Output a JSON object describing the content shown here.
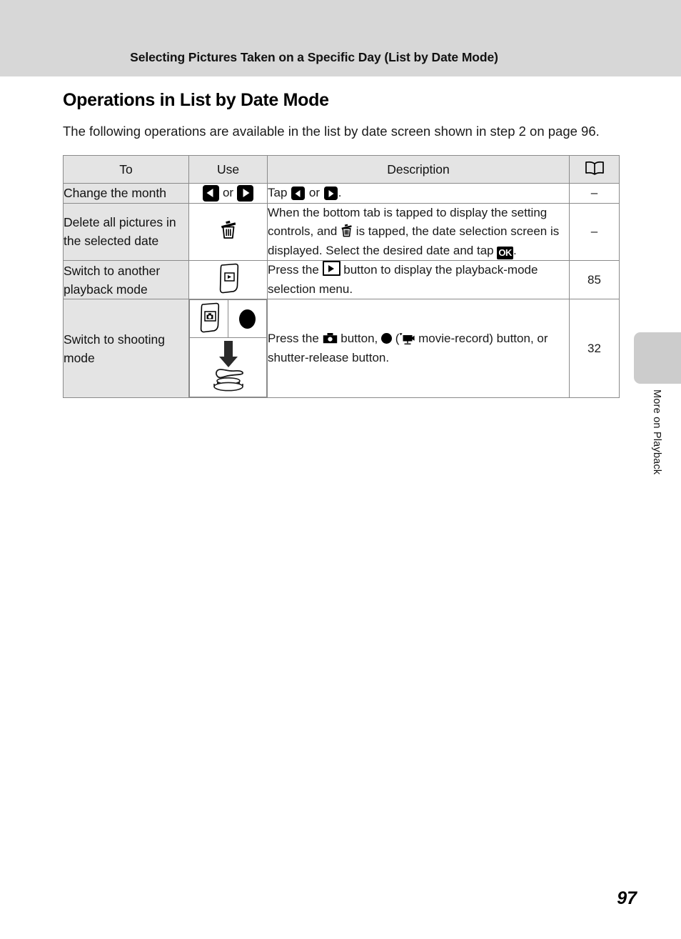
{
  "header": {
    "running_title": "Selecting Pictures Taken on a Specific Day (List by Date Mode)"
  },
  "section": {
    "title": "Operations in List by Date Mode",
    "intro": "The following operations are available in the list by date screen shown in step 2 on page 96."
  },
  "table": {
    "columns": {
      "to": "To",
      "use": "Use",
      "description": "Description",
      "reference_icon": "open-book-icon"
    },
    "rows": [
      {
        "to": "Change the month",
        "use_icons": [
          "left-arrow-button-icon",
          "or",
          "right-arrow-button-icon"
        ],
        "use_connector": "or",
        "description_parts": [
          {
            "type": "text",
            "value": "Tap "
          },
          {
            "type": "icon",
            "value": "left-arrow-button-icon"
          },
          {
            "type": "text",
            "value": " or "
          },
          {
            "type": "icon",
            "value": "right-arrow-button-icon"
          },
          {
            "type": "text",
            "value": "."
          }
        ],
        "description_plain": "Tap ◀ or ▶.",
        "reference": "–"
      },
      {
        "to": "Delete all pictures in the selected date",
        "use_icons": [
          "trash-can-icon"
        ],
        "description_parts": [
          {
            "type": "text",
            "value": "When the bottom tab is tapped to display the setting controls, and "
          },
          {
            "type": "icon",
            "value": "trash-can-icon"
          },
          {
            "type": "text",
            "value": " is tapped, the date selection screen is displayed. Select the desired date and tap "
          },
          {
            "type": "icon",
            "value": "ok-button-icon"
          },
          {
            "type": "text",
            "value": "."
          }
        ],
        "description_plain": "When the bottom tab is tapped to display the setting controls, and 🗑 is tapped, the date selection screen is displayed. Select the desired date and tap OK.",
        "ok_label": "OK",
        "reference": "–"
      },
      {
        "to": "Switch to another playback mode",
        "use_icons": [
          "playback-button-icon"
        ],
        "description_parts": [
          {
            "type": "text",
            "value": "Press the "
          },
          {
            "type": "icon",
            "value": "playback-button-icon"
          },
          {
            "type": "text",
            "value": " button to display the playback-mode selection menu."
          }
        ],
        "description_plain": "Press the ▶ button to display the playback-mode selection menu.",
        "reference": "85"
      },
      {
        "to": "Switch to shooting mode",
        "use_icons": [
          "camera-mode-button-icon",
          "movie-record-button-icon",
          "shutter-release-press-icon"
        ],
        "description_parts": [
          {
            "type": "text",
            "value": "Press the "
          },
          {
            "type": "icon",
            "value": "camera-button-icon"
          },
          {
            "type": "text",
            "value": " button, "
          },
          {
            "type": "icon",
            "value": "record-dot-icon"
          },
          {
            "type": "text",
            "value": " ("
          },
          {
            "type": "icon",
            "value": "movie-camera-icon"
          },
          {
            "type": "text",
            "value": " movie-record) button, or shutter-release button."
          }
        ],
        "description_plain": "Press the 📷 button, ● (🎥 movie-record) button, or shutter-release button.",
        "reference": "32"
      }
    ]
  },
  "side_tab": {
    "label": "More on Playback"
  },
  "footer": {
    "page_number": "97"
  },
  "colors": {
    "header_band": "#d7d7d7",
    "table_header_bg": "#e4e4e4",
    "first_column_bg": "#e4e4e4",
    "table_border": "#8a8a8a",
    "side_tab": "#cccccc",
    "text": "#111111"
  }
}
